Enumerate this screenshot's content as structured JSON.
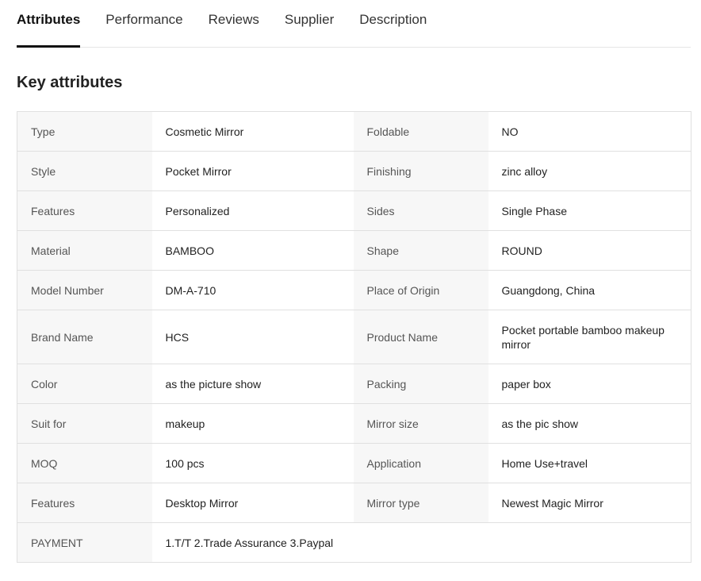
{
  "tabs": [
    {
      "label": "Attributes",
      "active": true
    },
    {
      "label": "Performance",
      "active": false
    },
    {
      "label": "Reviews",
      "active": false
    },
    {
      "label": "Supplier",
      "active": false
    },
    {
      "label": "Description",
      "active": false
    }
  ],
  "section_title": "Key attributes",
  "attributes": [
    {
      "k1": "Type",
      "v1": "Cosmetic Mirror",
      "k2": "Foldable",
      "v2": "NO"
    },
    {
      "k1": "Style",
      "v1": "Pocket Mirror",
      "k2": "Finishing",
      "v2": "zinc alloy"
    },
    {
      "k1": "Features",
      "v1": "Personalized",
      "k2": "Sides",
      "v2": "Single Phase"
    },
    {
      "k1": "Material",
      "v1": "BAMBOO",
      "k2": "Shape",
      "v2": "ROUND"
    },
    {
      "k1": "Model Number",
      "v1": "DM-A-710",
      "k2": "Place of Origin",
      "v2": "Guangdong, China"
    },
    {
      "k1": "Brand Name",
      "v1": "HCS",
      "k2": "Product Name",
      "v2": "Pocket portable bamboo makeup mirror"
    },
    {
      "k1": "Color",
      "v1": "as the picture show",
      "k2": "Packing",
      "v2": "paper box"
    },
    {
      "k1": "Suit for",
      "v1": "makeup",
      "k2": "Mirror size",
      "v2": "as the pic show"
    },
    {
      "k1": "MOQ",
      "v1": "100 pcs",
      "k2": "Application",
      "v2": "Home Use+travel"
    },
    {
      "k1": "Features",
      "v1": "Desktop Mirror",
      "k2": "Mirror type",
      "v2": "Newest Magic Mirror"
    }
  ],
  "payment": {
    "label": "PAYMENT",
    "value": "1.T/T 2.Trade Assurance 3.Paypal"
  }
}
